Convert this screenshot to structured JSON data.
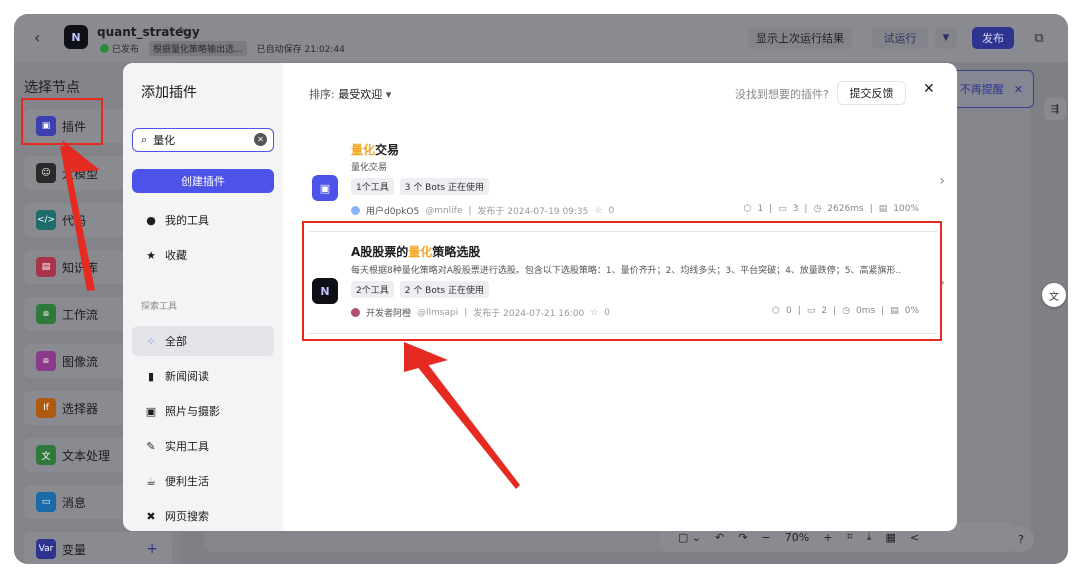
{
  "app": {
    "back_icon": "chevron-left-icon",
    "logo_text": "N",
    "name": "quant_strategy",
    "status": "已发布",
    "meta_tag": "根据量化策略输出选...",
    "autosave": "已自动保存 21:02:44"
  },
  "toolbar": {
    "last_result": "显示上次运行结果",
    "trial_run": "试运行",
    "publish": "发布"
  },
  "node_panel": {
    "title": "选择节点",
    "items": [
      {
        "label": "插件",
        "icon": "plugin-icon",
        "color": "#3b3fb0"
      },
      {
        "label": "大模型",
        "icon": "llm-icon",
        "color": "#2a2a2a"
      },
      {
        "label": "代码",
        "icon": "code-icon",
        "color": "#1f6a6a"
      },
      {
        "label": "知识库",
        "icon": "knowledge-icon",
        "color": "#a8334a"
      },
      {
        "label": "工作流",
        "icon": "workflow-icon",
        "color": "#2f7a3a"
      },
      {
        "label": "图像流",
        "icon": "imageflow-icon",
        "color": "#8a3a8a"
      },
      {
        "label": "选择器",
        "icon": "selector-icon",
        "color": "#b05a10"
      },
      {
        "label": "文本处理",
        "icon": "text-icon",
        "color": "#2f7a3a"
      },
      {
        "label": "消息",
        "icon": "message-icon",
        "color": "#1a6aa8"
      },
      {
        "label": "变量",
        "icon": "variable-icon",
        "color": "#2f3390"
      }
    ]
  },
  "canvas": {
    "reminder": "不再提醒",
    "zoom": "70%"
  },
  "modal": {
    "title": "添加插件",
    "search_value": "量化",
    "create_button": "创建插件",
    "nav_my": "我的工具",
    "nav_fav": "收藏",
    "section_explore": "探索工具",
    "categories": [
      {
        "label": "全部",
        "icon": "grid-icon",
        "active": true
      },
      {
        "label": "新闻阅读",
        "icon": "book-icon",
        "active": false
      },
      {
        "label": "照片与摄影",
        "icon": "photo-icon",
        "active": false
      },
      {
        "label": "实用工具",
        "icon": "wrench-icon",
        "active": false
      },
      {
        "label": "便利生活",
        "icon": "cup-icon",
        "active": false
      },
      {
        "label": "网页搜索",
        "icon": "web-search-icon",
        "active": false
      }
    ],
    "sort_label": "排序:",
    "sort_value": "最受欢迎",
    "not_found": "没找到想要的插件?",
    "feedback": "提交反馈",
    "plugins": [
      {
        "title_hl": "量化",
        "title_rest": "交易",
        "desc": "量化交易",
        "tags": [
          "1个工具",
          "3 个 Bots 正在使用"
        ],
        "author": "用户d0pkO5",
        "handle": "@mnlife",
        "published": "发布于 2024-07-19 09:35",
        "stars": "0",
        "stat_a": "1",
        "stat_b": "3",
        "latency": "2626ms",
        "success": "100%",
        "logo_color": "#4d53e8"
      },
      {
        "title_pre": "A股股票的",
        "title_hl": "量化",
        "title_rest": "策略选股",
        "desc": "每天根据8种量化策略对A股股票进行选股。包含以下选股策略：1、量价齐升；2、均线多头；3、平台突破；4、放量跌停；5、高紧旗形...",
        "tags": [
          "2个工具",
          "2 个 Bots 正在使用"
        ],
        "author": "开发者阿橙",
        "handle": "@llmsapi",
        "published": "发布于 2024-07-21 16:00",
        "stars": "0",
        "stat_a": "0",
        "stat_b": "2",
        "latency": "0ms",
        "success": "0%",
        "logo_color": "#0f1015"
      }
    ]
  },
  "annotation_color": "#e52a22"
}
